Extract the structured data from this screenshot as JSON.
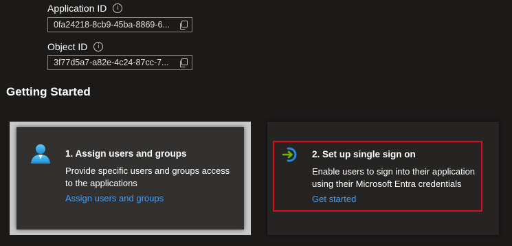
{
  "properties": {
    "application_id": {
      "label": "Application ID",
      "value": "0fa24218-8cb9-45ba-8869-6..."
    },
    "object_id": {
      "label": "Object ID",
      "value": "3f77d5a7-a82e-4c24-87cc-7..."
    }
  },
  "getting_started": {
    "title": "Getting Started",
    "cards": [
      {
        "title": "1. Assign users and groups",
        "description_line1": "Provide specific users and groups access",
        "description_line2": "to the applications",
        "link": "Assign users and groups",
        "icon": "user-icon"
      },
      {
        "title": "2. Set up single sign on",
        "description_line1": "Enable users to sign into their application",
        "description_line2": "using their Microsoft Entra credentials",
        "link": "Get started",
        "icon": "sign-in-arrow-icon"
      }
    ]
  },
  "colors": {
    "background": "#1b1a19",
    "link": "#479ef5",
    "highlight_border": "#e00b1c"
  }
}
